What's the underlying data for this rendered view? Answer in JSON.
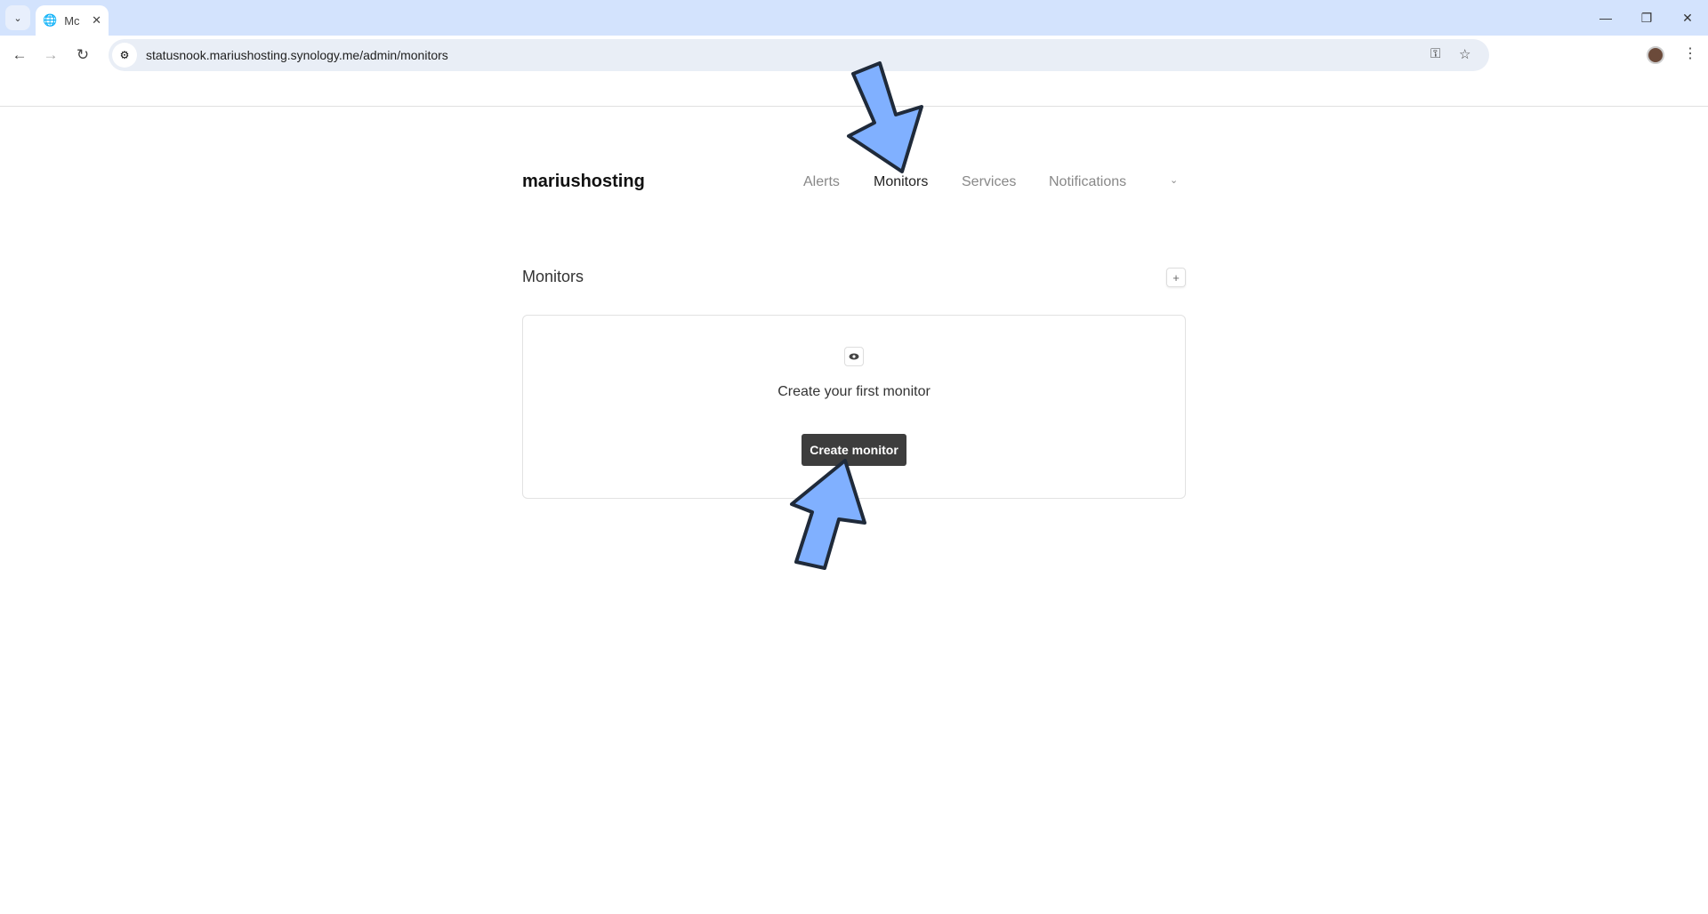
{
  "browser": {
    "tab_title": "Mc",
    "url": "statusnook.mariushosting.synology.me/admin/monitors"
  },
  "header": {
    "brand": "mariushosting",
    "nav": [
      {
        "label": "Alerts"
      },
      {
        "label": "Monitors",
        "active": true
      },
      {
        "label": "Services"
      },
      {
        "label": "Notifications"
      }
    ],
    "chevron": "⌄"
  },
  "main": {
    "title": "Monitors",
    "add_label": "+",
    "empty_text": "Create your first monitor",
    "create_button": "Create monitor"
  },
  "colors": {
    "arrow": "#80b0ff",
    "button": "#3d3d3d"
  }
}
